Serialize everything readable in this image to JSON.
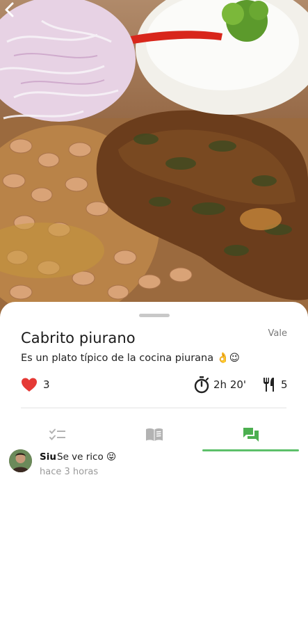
{
  "recipe": {
    "title": "Cabrito piurano",
    "author": "Vale",
    "description": "Es un plato típico de la cocina piurana 👌😉",
    "likes": "3",
    "time": "2h 20'",
    "servings": "5"
  },
  "icons": {
    "back": "chevron-left-icon",
    "like": "heart-icon",
    "time": "timer-icon",
    "servings": "fork-knife-icon",
    "tab_ingredients": "checklist-icon",
    "tab_steps": "book-icon",
    "tab_comments": "chat-icon"
  },
  "tabs": {
    "active_index": 2,
    "active_color": "#5cc06a",
    "inactive_color": "#b3b3b3"
  },
  "comments": [
    {
      "user": "Siu",
      "text": "Se ve rico 😝",
      "time": "hace 3 horas"
    }
  ],
  "colors": {
    "accent": "#5cc06a",
    "like": "#e53935"
  }
}
